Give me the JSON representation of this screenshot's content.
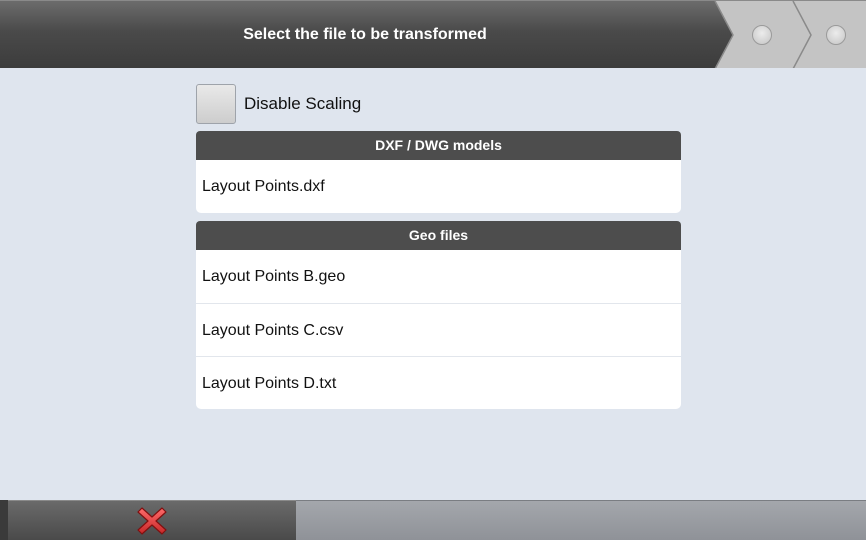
{
  "header": {
    "title": "Select the file to be transformed",
    "steps": [
      {
        "icon": "step-indicator-icon",
        "state": "inactive"
      },
      {
        "icon": "step-indicator-icon",
        "state": "inactive"
      }
    ]
  },
  "options": {
    "disable_scaling_label": "Disable Scaling",
    "disable_scaling_checked": false
  },
  "sections": {
    "dxf": {
      "title": "DXF / DWG models",
      "files": [
        "Layout Points.dxf"
      ]
    },
    "geo": {
      "title": "Geo files",
      "files": [
        "Layout Points B.geo",
        "Layout Points C.csv",
        "Layout Points D.txt"
      ]
    }
  },
  "footer": {
    "cancel_icon": "close-icon",
    "cancel_color": "#e53935"
  },
  "colors": {
    "header_bg": "#4a4a4a",
    "section_header_bg": "#4d4d4d",
    "background": "#dfe5ee",
    "list_bg": "#ffffff"
  }
}
